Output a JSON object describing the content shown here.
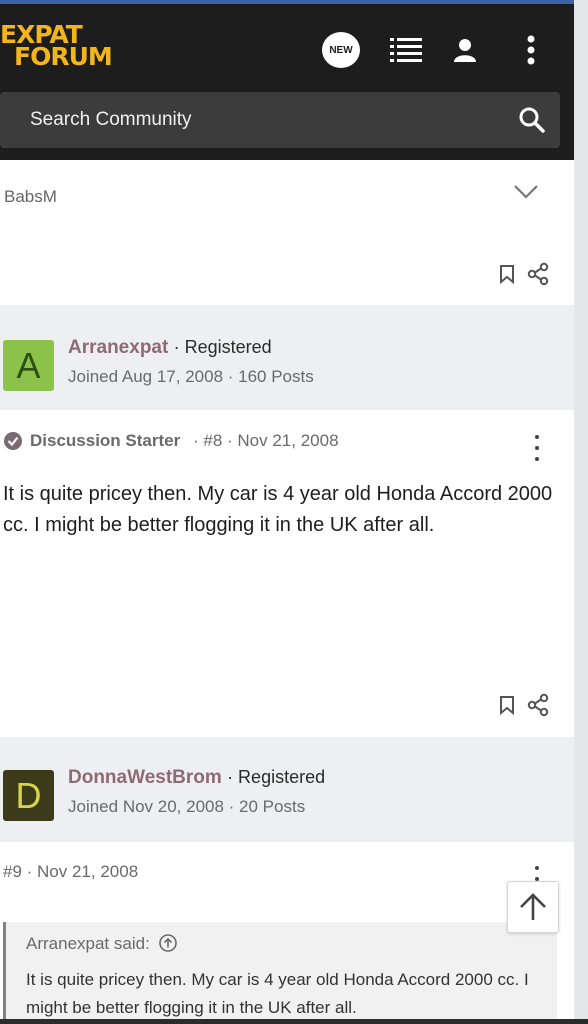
{
  "header": {
    "logo_line1": "EXPAT",
    "logo_line2": "FORUM",
    "new_badge": "NEW",
    "search_placeholder": "Search Community"
  },
  "prev_post": {
    "quote_author_collapsed": "BabsM"
  },
  "post8": {
    "author": "Arranexpat",
    "role": "· Registered",
    "joined": "Joined Aug 17, 2008 · 160 Posts",
    "avatar_letter": "A",
    "avatar_color": "#8bc34a",
    "starter_label": "Discussion Starter",
    "number_date": "· #8 · Nov 21, 2008",
    "body": "It is quite pricey then. My car is 4 year old Honda Accord 2000 cc. I might be better flogging it in the UK after all."
  },
  "post9": {
    "author": "DonnaWestBrom",
    "role": "· Registered",
    "joined": "Joined Nov 20, 2008 · 20 Posts",
    "avatar_letter": "D",
    "avatar_color": "#3b3b1a",
    "number_date": "#9 · Nov 21, 2008",
    "quote_author": "Arranexpat said:",
    "quote_text": "It is quite pricey then. My car is 4 year old Honda Accord 2000 cc. I might be better flogging it in the UK after all."
  },
  "colors": {
    "header_bg": "#1d1d1d",
    "logo": "#f2b51c",
    "username": "#8f6a73"
  }
}
